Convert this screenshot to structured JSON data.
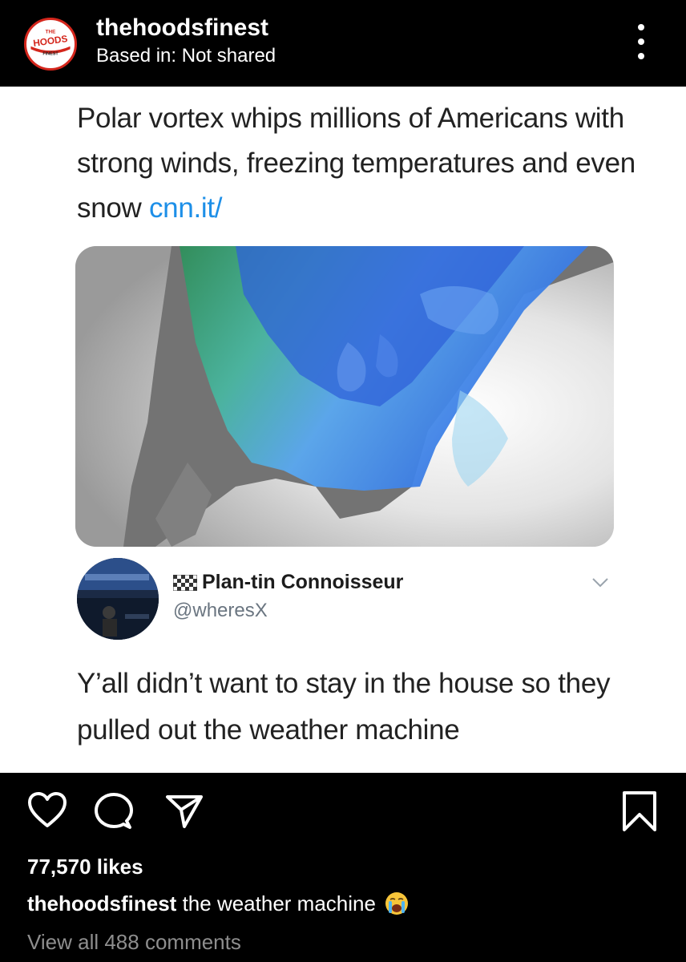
{
  "post": {
    "username": "thehoodsfinest",
    "location": "Based in: Not shared",
    "avatar_text": [
      "THE",
      "HOODS",
      "FINEST"
    ]
  },
  "content": {
    "headline": "Polar vortex whips millions of Americans with strong winds, freezing temperatures and even snow",
    "headline_link": "cnn.it/",
    "tweet": {
      "display_name": "Plan-tin Connoisseur",
      "handle": "@wheresX",
      "text": "Y’all didn’t want to stay in the house so they pulled out the weather machine"
    }
  },
  "engagement": {
    "likes": "77,570 likes",
    "caption_user": "thehoodsfinest",
    "caption_text": "the weather machine",
    "caption_emoji": "loudly-crying-face-icon",
    "view_comments": "View all 488 comments"
  },
  "colors": {
    "link": "#1d8fe8",
    "handle": "#6a7580",
    "muted": "#8e8e8e",
    "brand_red": "#d4261c"
  }
}
